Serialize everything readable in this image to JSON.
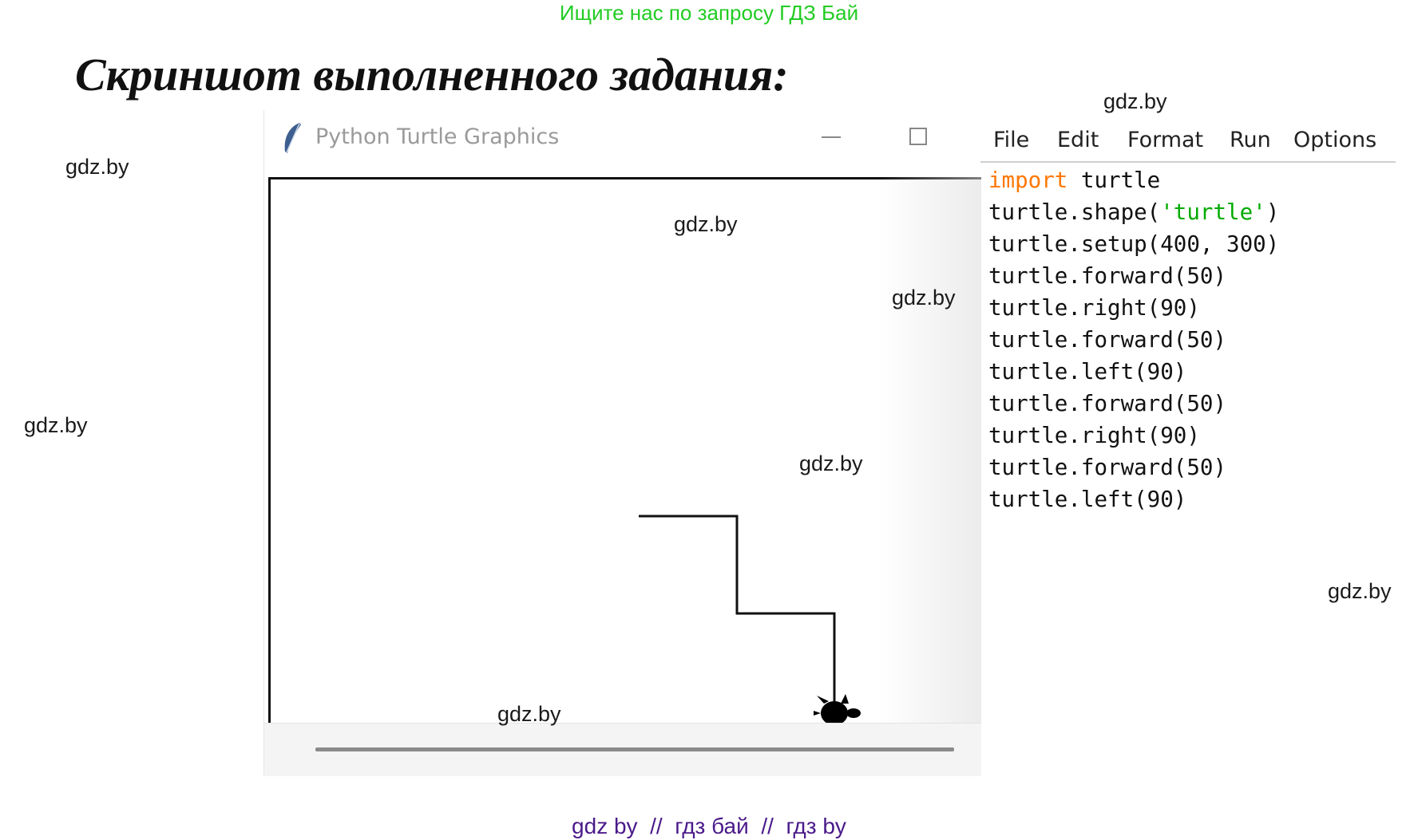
{
  "banner": "Ищите нас по запросу ГДЗ Бай",
  "heading": "Скриншот выполненного задания:",
  "watermarks": [
    "gdz.by",
    "gdz.by",
    "gdz.by",
    "gdz.by",
    "gdz.by",
    "gdz.by",
    "gdz.by",
    "gdz.by"
  ],
  "turtle_window": {
    "title": "Python Turtle Graphics"
  },
  "editor": {
    "menu": [
      "File",
      "Edit",
      "Format",
      "Run",
      "Options"
    ],
    "code": [
      {
        "kw": "import",
        "rest": " turtle"
      },
      {
        "pre": "turtle.shape(",
        "str": "'turtle'",
        "post": ")"
      },
      {
        "text": "turtle.setup(400, 300)"
      },
      {
        "text": "turtle.forward(50)"
      },
      {
        "text": "turtle.right(90)"
      },
      {
        "text": "turtle.forward(50)"
      },
      {
        "text": "turtle.left(90)"
      },
      {
        "text": "turtle.forward(50)"
      },
      {
        "text": "turtle.right(90)"
      },
      {
        "text": "turtle.forward(50)"
      },
      {
        "text": "turtle.left(90)"
      }
    ]
  },
  "footer": {
    "link1": "gdz by",
    "sep1": "//",
    "link2": "гдз бай",
    "sep2": "//",
    "link3": "гдз by"
  },
  "colors": {
    "banner": "#22cc22",
    "keyword": "#ff7700",
    "string": "#00aa00",
    "footer": "#4a1a8a"
  }
}
